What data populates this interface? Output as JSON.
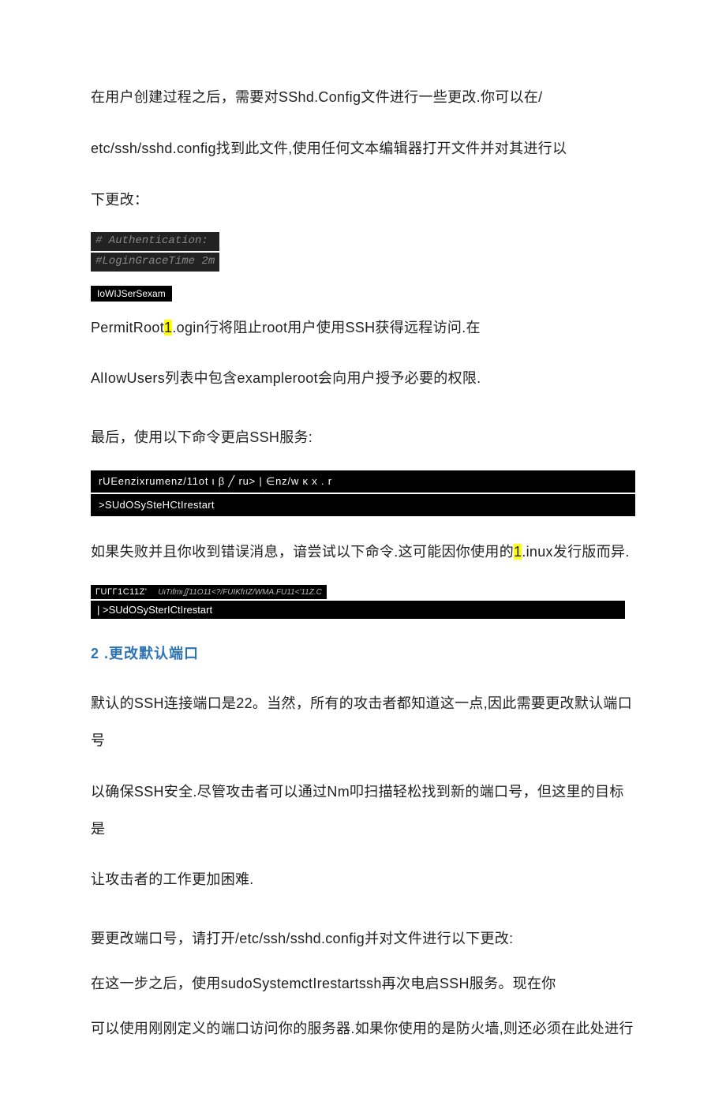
{
  "p1": "在用户创建过程之后，需要对SShd.Config文件进行一些更改.你可以在/",
  "p2": "etc/ssh/sshd.config找到此文件,使用任何文本编辑器打开文件并对其进行以",
  "p3": "下更改：",
  "auth_l1": "# Authentication:",
  "auth_l2": "#LoginGraceTime 2m",
  "allow_tag": "IoWIJSerSexam",
  "p4a": "PermitRoot",
  "p4hl": "1",
  "p4b": ".ogin行将阻止root用户使用SSH获得远程访问.在",
  "p5": "AlIowUsers列表中包含exampleroot会向用户授予必要的权限.",
  "p6": "最后，使用以下命令更启SSH服务:",
  "code1_l1": "rUEenzixrumenz/11ot ι β ╱ ru> | ∈nz/w κ x . r",
  "code1_l2": ">SUdOSySteHCtIrestart",
  "p7a": "如果失败并且你收到错误消息，谙尝试以下命令.这可能因你使用的",
  "p7hl": "1",
  "p7b": ".inux发行版而异.",
  "blk2_tag": "ΓUΓΓ1C11Z'",
  "blk2_sub": "UιTιfmι∬11O11<?/FUIKfrIZ/WMA.FU11<'11Z.C",
  "blk2_row2": "| >SUdOSySterICtIrestart",
  "sec2": "2  .更改默认端口",
  "p8": "默认的SSH连接端口是22。当然，所有的攻击者都知道这一点,因此需要更改默认端口号",
  "p9": "以确保SSH安全.尽管攻击者可以通过Nm叩扫描轻松找到新的端口号，但这里的目标是",
  "p10": "让攻击者的工作更加困难.",
  "p11": "要更改端口号，请打开/etc/ssh/sshd.config并对文件进行以下更改:",
  "p12": "在这一步之后，使用sudoSystemctIrestartssh再次电启SSH服务。现在你",
  "p13": "可以使用刚刚定义的端口访问你的服务器.如果你使用的是防火墙,则还必须在此处进行"
}
